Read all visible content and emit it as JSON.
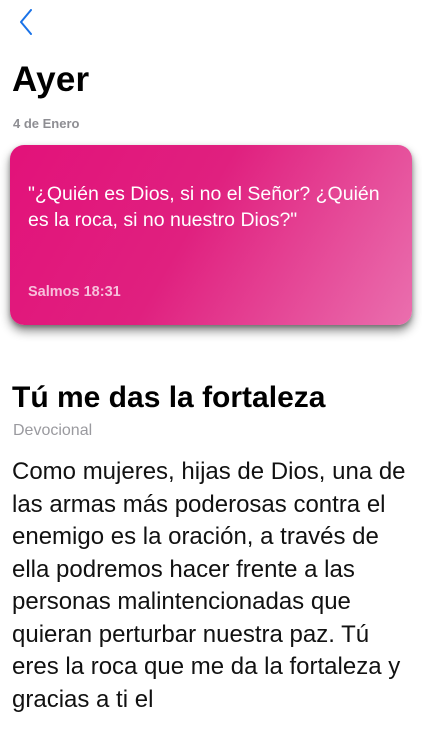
{
  "nav": {
    "back_icon": "chevron-left-icon",
    "accent_color": "#1a73e8"
  },
  "header": {
    "title": "Ayer",
    "date": "4 de Enero"
  },
  "verse_card": {
    "text": "\"¿Quién es Dios, si no el Señor? ¿Quién es la roca, si no nuestro Dios?\"",
    "reference": "Salmos 18:31",
    "gradient_start": "#e2127a",
    "gradient_end": "#ea6fae"
  },
  "article": {
    "title": "Tú me das la fortaleza",
    "category": "Devocional",
    "body": "Como mujeres, hijas de Dios, una de las armas más poderosas contra el enemigo es la oración, a través de ella podremos hacer frente a las personas malintencionadas que quieran perturbar nuestra paz. Tú eres la roca que me da la fortaleza y gracias a ti el"
  }
}
